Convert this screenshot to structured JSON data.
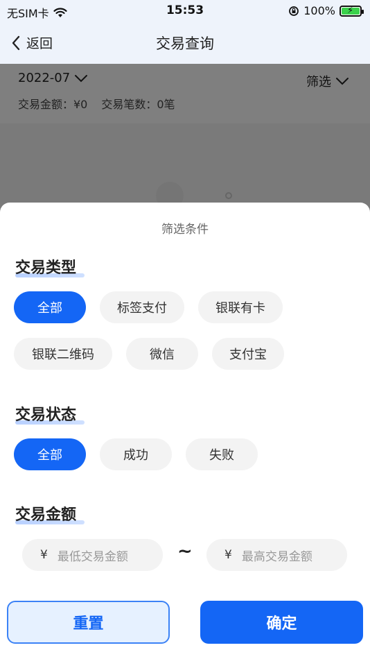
{
  "status_bar": {
    "carrier": "无SIM卡",
    "time": "15:53",
    "battery": "100%"
  },
  "nav": {
    "back_label": "返回",
    "title": "交易查询"
  },
  "summary": {
    "month": "2022-07",
    "filter_label": "筛选",
    "amount_text": "交易金额：¥0",
    "count_text": "交易笔数：0笔"
  },
  "sheet": {
    "title": "筛选条件",
    "type_section": {
      "title": "交易类型",
      "options": [
        "全部",
        "标签支付",
        "银联有卡",
        "银联二维码",
        "微信",
        "支付宝"
      ],
      "selected": "全部"
    },
    "status_section": {
      "title": "交易状态",
      "options": [
        "全部",
        "成功",
        "失败"
      ],
      "selected": "全部"
    },
    "amount_section": {
      "title": "交易金额",
      "currency": "¥",
      "min_placeholder": "最低交易金额",
      "max_placeholder": "最高交易金额",
      "separator": "~"
    },
    "reset_label": "重置",
    "confirm_label": "确定"
  },
  "colors": {
    "accent": "#1466f5",
    "chip_bg": "#f3f3f3",
    "reset_bg": "#e6f1ff"
  }
}
